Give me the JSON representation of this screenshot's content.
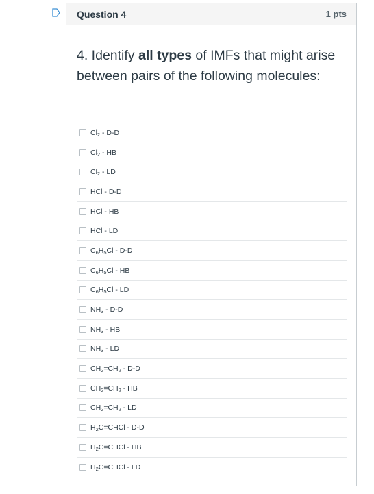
{
  "question": {
    "title": "Question 4",
    "points": "1 pts",
    "text_number": "4. Identify ",
    "text_bold": "all types",
    "text_rest": " of IMFs that might arise between pairs of the following molecules:"
  },
  "answers": [
    {
      "mol": "Cl",
      "sub": "2",
      "rest": "",
      "imf": " - D-D"
    },
    {
      "mol": "Cl",
      "sub": "2",
      "rest": "",
      "imf": " - HB"
    },
    {
      "mol": "Cl",
      "sub": "2",
      "rest": "",
      "imf": " - LD"
    },
    {
      "mol": "HCl",
      "sub": "",
      "rest": "",
      "imf": " - D-D"
    },
    {
      "mol": "HCl",
      "sub": "",
      "rest": "",
      "imf": " - HB"
    },
    {
      "mol": "HCl",
      "sub": "",
      "rest": "",
      "imf": " - LD"
    },
    {
      "mol": "C",
      "sub": "6",
      "rest": "H",
      "sub2": "5",
      "rest2": "Cl",
      "imf": " - D-D"
    },
    {
      "mol": "C",
      "sub": "6",
      "rest": "H",
      "sub2": "5",
      "rest2": "Cl",
      "imf": " - HB"
    },
    {
      "mol": "C",
      "sub": "6",
      "rest": "H",
      "sub2": "5",
      "rest2": "Cl",
      "imf": " - LD"
    },
    {
      "mol": "NH",
      "sub": "3",
      "rest": "",
      "imf": " - D-D"
    },
    {
      "mol": "NH",
      "sub": "3",
      "rest": "",
      "imf": " - HB"
    },
    {
      "mol": "NH",
      "sub": "3",
      "rest": "",
      "imf": " - LD"
    },
    {
      "mol": "CH",
      "sub": "2",
      "rest": "=CH",
      "sub2": "2",
      "rest2": "",
      "imf": " - D-D"
    },
    {
      "mol": "CH",
      "sub": "2",
      "rest": "=CH",
      "sub2": "2",
      "rest2": "",
      "imf": " - HB"
    },
    {
      "mol": "CH",
      "sub": "2",
      "rest": "=CH",
      "sub2": "2",
      "rest2": "",
      "imf": " - LD"
    },
    {
      "mol": "H",
      "sub": "2",
      "rest": "C=CHCl",
      "imf": " - D-D"
    },
    {
      "mol": "H",
      "sub": "2",
      "rest": "C=CHCl",
      "imf": " - HB"
    },
    {
      "mol": "H",
      "sub": "2",
      "rest": "C=CHCl",
      "imf": " - LD"
    }
  ],
  "colors": {
    "flag": "#3b8fd4",
    "header_bg": "#f5f5f5",
    "border": "#c7cdd1",
    "text": "#2d3b45"
  },
  "icons": {
    "flag": "bookmark-flag-icon"
  }
}
